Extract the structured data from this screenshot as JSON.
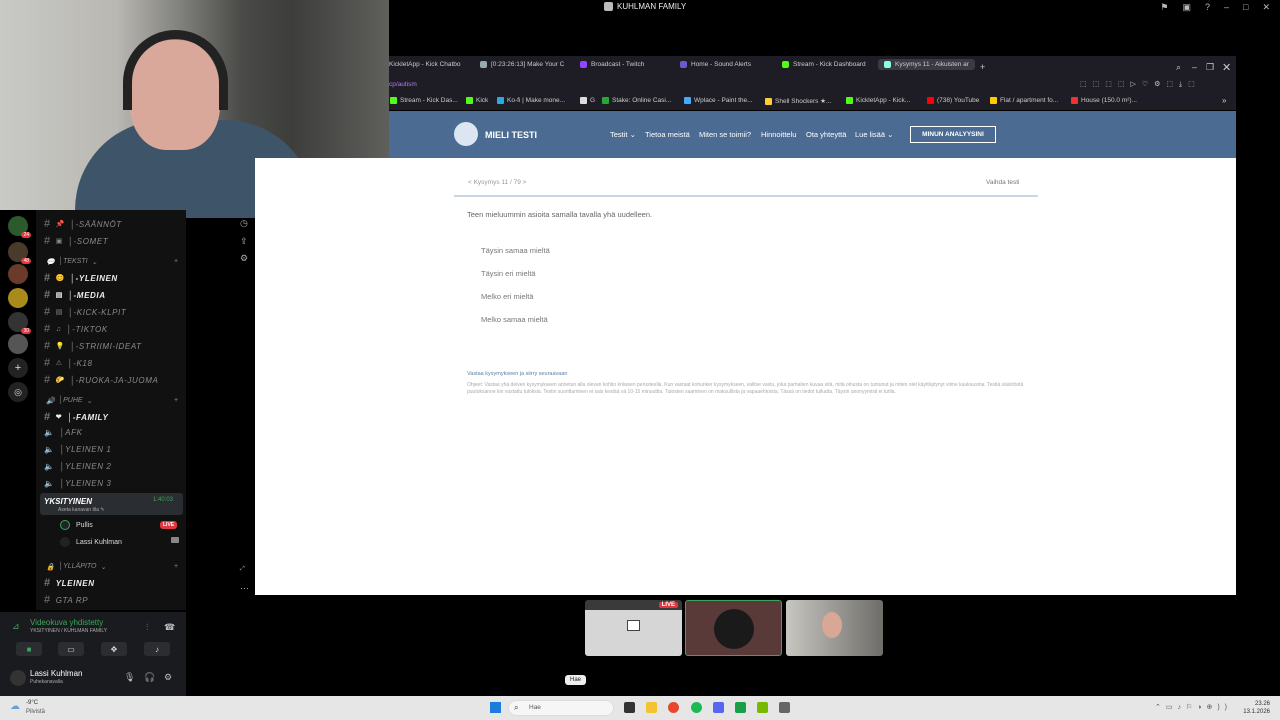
{
  "window": {
    "title": "KUHLMAN FAMILY"
  },
  "discord": {
    "server_badges": [
      "24",
      "48",
      "30"
    ],
    "channels_top": [
      {
        "name": "│-SÄÄNNÖT",
        "emoji": "📌"
      },
      {
        "name": "│-SOMET",
        "emoji": "▣"
      }
    ],
    "category_text": "│TEKSTI",
    "text_channels": [
      {
        "name": "│-YLEINEN",
        "emoji": "😊",
        "bold": true
      },
      {
        "name": "│-MEDIA",
        "emoji": "▤",
        "bold": true
      },
      {
        "name": "│-KICK-KLPIT",
        "emoji": "▤",
        "bold": false
      },
      {
        "name": "│-TIKTOK",
        "emoji": "♫",
        "bold": false
      },
      {
        "name": "│-STRIIMI-IDEAT",
        "emoji": "💡",
        "bold": false
      },
      {
        "name": "│-K18",
        "emoji": "⚠",
        "bold": false
      },
      {
        "name": "│-RUOKA-JA-JUOMA",
        "emoji": "🌮",
        "bold": false
      }
    ],
    "category_voice": "│PUHE",
    "voice_channels": [
      {
        "name": "│-FAMILY",
        "emoji": "❤",
        "type": "text"
      },
      {
        "name": "│AFK",
        "type": "voice"
      },
      {
        "name": "│YLEINEN 1",
        "type": "voice"
      },
      {
        "name": "│YLEINEN 2",
        "type": "voice"
      },
      {
        "name": "│YLEINEN 3",
        "type": "voice"
      }
    ],
    "active_vc": {
      "name": "YKSITYINEN",
      "time": "1:40:03",
      "sub": "Aseta kanavan tila ✎"
    },
    "members": [
      {
        "name": "Pullis",
        "live": "LIVE"
      },
      {
        "name": "Lassi Kuhlman"
      }
    ],
    "category_admin": "│YLLÄPITO",
    "admin_channels": [
      "YLEINEN",
      "GTA RP"
    ],
    "voice_status": {
      "title": "Videokuva yhdistetty",
      "sub": "YKSITYINEN / KUHLMAN FAMILY"
    },
    "user": {
      "name": "Lassi Kuhlman",
      "status": "Puhekanavalla"
    }
  },
  "browser": {
    "tabs": [
      {
        "label": "KickletApp - Kick Chatbo",
        "color": "#53fc18"
      },
      {
        "label": "[0:23:26:13] Make Your C",
        "color": "#9aa"
      },
      {
        "label": "Broadcast - Twitch",
        "color": "#9146ff"
      },
      {
        "label": "Home - Sound Alerts",
        "color": "#6a5acd"
      },
      {
        "label": "Stream - Kick Dashboard",
        "color": "#53fc18"
      },
      {
        "label": "Kysymys 11 - Aikuisten ar",
        "color": "#8fd",
        "active": true
      }
    ],
    "url": "cp/autism",
    "bookmarks": [
      {
        "label": "Stream - Kick Das...",
        "color": "#53fc18"
      },
      {
        "label": "Kick",
        "color": "#53fc18"
      },
      {
        "label": "Ko-fi | Make mone...",
        "color": "#29abe0"
      },
      {
        "label": "G",
        "color": "#ddd"
      },
      {
        "label": "Stake: Online Casi...",
        "color": "#2a3"
      },
      {
        "label": "Wplace - Paint the...",
        "color": "#4af"
      },
      {
        "label": "Shell Shockers ★...",
        "color": "#fc3"
      },
      {
        "label": "KickletApp - Kick...",
        "color": "#53fc18"
      },
      {
        "label": "(738) YouTube",
        "color": "#f00"
      },
      {
        "label": "Flat / apartment fo...",
        "color": "#fc0"
      },
      {
        "label": "House (150.0 m²)...",
        "color": "#e33"
      }
    ]
  },
  "site": {
    "logo": "MIELI TESTI",
    "nav": [
      "Testit ⌄",
      "Tietoa meistä",
      "Miten se toimii?",
      "Hinnoittelu",
      "Ota yhteyttä",
      "Lue lisää ⌄"
    ],
    "cta": "MINUN ANALYYSINI",
    "question_nav": "<   Kysymys 11 / 79   >",
    "switch_test": "Vaihda testi",
    "question": "Teen mieluummin asioita samalla tavalla yhä uudelleen.",
    "options": [
      "Täysin samaa mieltä",
      "Täysin eri mieltä",
      "Melko eri mieltä",
      "Melko samaa mieltä"
    ],
    "info_title": "Vastaa kysymykseen ja siirry seuraavaan",
    "info_text": "Ohjeet: Vastaa yhä deiven kysymykseen annetun alla olevan kohtin kriiwsen perusteella. Kun vastaat kohunker kysymykseen, valitse vastu, joka parhaiten kuvaa sitä, mitä olnusta on tuntunut ja miten olet käyttäytynyt viime kuukausina. Testiä sääntöstä puutoksanne kin vastattu tuloksia. Testin suorittaminen ei sais kestää vä 10-15 minuuttia. Tulosten saaminen on maksullista ja vapaaehtoista. Tässä on tiedot tulkatta. Täysin anonyymisti ei tutila."
  },
  "participants": {
    "live": "LIVE"
  },
  "tooltip": "Hae",
  "taskbar": {
    "weather_temp": "-9°C",
    "weather_desc": "Pilvistä",
    "search_placeholder": "Hae",
    "time": "23.26",
    "date": "13.1.2026"
  }
}
